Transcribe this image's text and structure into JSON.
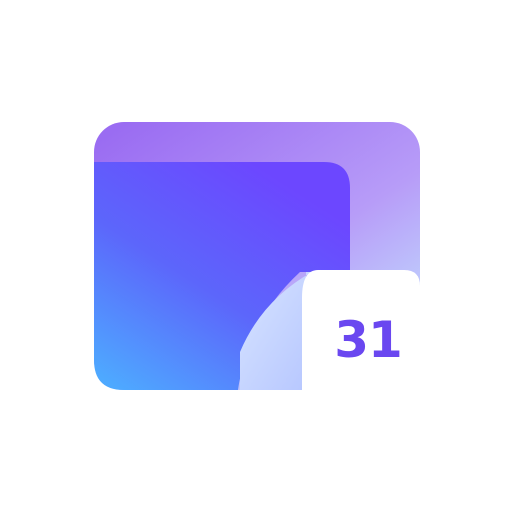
{
  "app_icon": {
    "name": "calendar-date-app-icon",
    "badge_number": "31",
    "colors": {
      "background": "#ffffff",
      "back_panel_top": "#9a6cf2",
      "back_panel_bottom": "#bfe6ff",
      "front_panel_top": "#6b48ff",
      "front_panel_bottom": "#4fa8ff",
      "page_curl": "#c9d8ff",
      "badge_card": "#ffffff",
      "badge_text": "#6a47f0"
    }
  }
}
